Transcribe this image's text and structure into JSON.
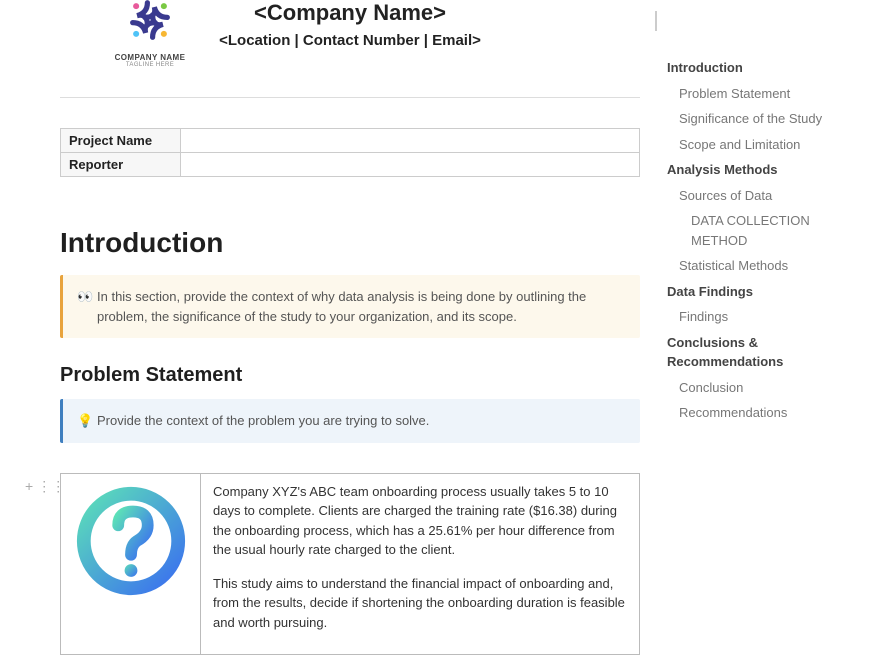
{
  "header": {
    "company_name": "<Company Name>",
    "contact_line": "<Location | Contact Number | Email>",
    "logo_text": "COMPANY NAME",
    "logo_tagline": "TAGLINE HERE"
  },
  "meta_table": {
    "rows": [
      {
        "label": "Project Name",
        "value": ""
      },
      {
        "label": "Reporter",
        "value": ""
      }
    ]
  },
  "sections": {
    "introduction_title": "Introduction",
    "introduction_callout_icon": "👀",
    "introduction_callout": "In this section, provide the context of why data analysis is being done by outlining the problem, the significance of the study to your organization, and its scope.",
    "problem_statement_title": "Problem Statement",
    "problem_statement_callout_icon": "💡",
    "problem_statement_callout": "Provide the context of the problem you are trying to solve.",
    "body_para1": "Company XYZ's ABC team onboarding process usually takes 5 to 10 days to complete. Clients are charged the training rate ($16.38) during the onboarding process, which has a 25.61% per hour difference from the usual hourly rate charged to the client.",
    "body_para2": "This study aims to understand the financial impact of onboarding and, from the results, decide if shortening the onboarding duration is feasible and worth pursuing."
  },
  "toc": [
    {
      "label": "Introduction",
      "level": 0
    },
    {
      "label": "Problem Statement",
      "level": 1
    },
    {
      "label": "Significance of the Study",
      "level": 1
    },
    {
      "label": "Scope and Limitation",
      "level": 1
    },
    {
      "label": "Analysis Methods",
      "level": 0
    },
    {
      "label": "Sources of Data",
      "level": 1
    },
    {
      "label": "DATA COLLECTION METHOD",
      "level": 2
    },
    {
      "label": "Statistical Methods",
      "level": 1
    },
    {
      "label": "Data Findings",
      "level": 0
    },
    {
      "label": "Findings",
      "level": 1
    },
    {
      "label": "Conclusions & Recommendations",
      "level": 0
    },
    {
      "label": "Conclusion",
      "level": 1
    },
    {
      "label": "Recommendations",
      "level": 1
    }
  ]
}
